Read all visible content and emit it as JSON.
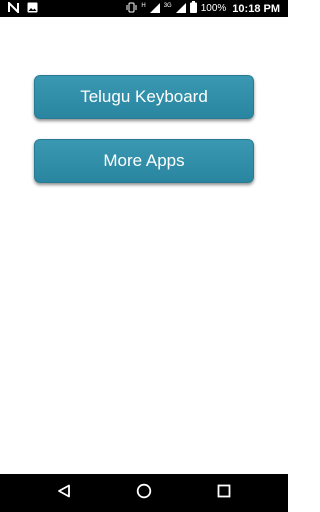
{
  "status_bar": {
    "left_icons": [
      "n-notification-icon",
      "image-notification-icon"
    ],
    "right_icons": [
      "vibrate-icon",
      "wifi-signal-icon",
      "cell-signal-icon",
      "battery-icon"
    ],
    "signal_small_label_1": "H",
    "signal_small_label_2": "3G",
    "battery_percent": "100%",
    "time": "10:18 PM"
  },
  "main": {
    "buttons": [
      {
        "label": "Telugu Keyboard"
      },
      {
        "label": "More Apps"
      }
    ],
    "button_color": "#2f8fa8",
    "button_text_color": "#ffffff"
  },
  "nav_bar": {
    "icons": [
      "back-icon",
      "home-icon",
      "recent-apps-icon"
    ]
  }
}
